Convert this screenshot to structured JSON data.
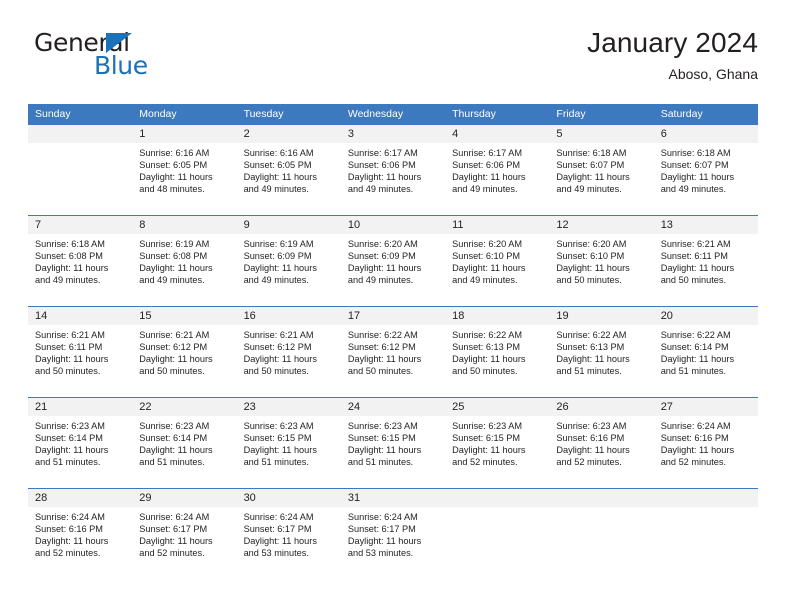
{
  "brand": {
    "name_top": "General",
    "name_bottom": "Blue",
    "triangle_icon": "blue-triangle-icon",
    "color_primary": "#1c71b8",
    "color_text": "#231f20"
  },
  "header": {
    "title": "January 2024",
    "subtitle": "Aboso, Ghana"
  },
  "calendar": {
    "header_bg": "#3d79bf",
    "daynum_bg": "#f2f2f2",
    "weekdays": [
      "Sunday",
      "Monday",
      "Tuesday",
      "Wednesday",
      "Thursday",
      "Friday",
      "Saturday"
    ],
    "weeks": [
      [
        {
          "day": "",
          "sunrise": "",
          "sunset": "",
          "daylight1": "",
          "daylight2": ""
        },
        {
          "day": "1",
          "sunrise": "Sunrise: 6:16 AM",
          "sunset": "Sunset: 6:05 PM",
          "daylight1": "Daylight: 11 hours",
          "daylight2": "and 48 minutes."
        },
        {
          "day": "2",
          "sunrise": "Sunrise: 6:16 AM",
          "sunset": "Sunset: 6:05 PM",
          "daylight1": "Daylight: 11 hours",
          "daylight2": "and 49 minutes."
        },
        {
          "day": "3",
          "sunrise": "Sunrise: 6:17 AM",
          "sunset": "Sunset: 6:06 PM",
          "daylight1": "Daylight: 11 hours",
          "daylight2": "and 49 minutes."
        },
        {
          "day": "4",
          "sunrise": "Sunrise: 6:17 AM",
          "sunset": "Sunset: 6:06 PM",
          "daylight1": "Daylight: 11 hours",
          "daylight2": "and 49 minutes."
        },
        {
          "day": "5",
          "sunrise": "Sunrise: 6:18 AM",
          "sunset": "Sunset: 6:07 PM",
          "daylight1": "Daylight: 11 hours",
          "daylight2": "and 49 minutes."
        },
        {
          "day": "6",
          "sunrise": "Sunrise: 6:18 AM",
          "sunset": "Sunset: 6:07 PM",
          "daylight1": "Daylight: 11 hours",
          "daylight2": "and 49 minutes."
        }
      ],
      [
        {
          "day": "7",
          "sunrise": "Sunrise: 6:18 AM",
          "sunset": "Sunset: 6:08 PM",
          "daylight1": "Daylight: 11 hours",
          "daylight2": "and 49 minutes."
        },
        {
          "day": "8",
          "sunrise": "Sunrise: 6:19 AM",
          "sunset": "Sunset: 6:08 PM",
          "daylight1": "Daylight: 11 hours",
          "daylight2": "and 49 minutes."
        },
        {
          "day": "9",
          "sunrise": "Sunrise: 6:19 AM",
          "sunset": "Sunset: 6:09 PM",
          "daylight1": "Daylight: 11 hours",
          "daylight2": "and 49 minutes."
        },
        {
          "day": "10",
          "sunrise": "Sunrise: 6:20 AM",
          "sunset": "Sunset: 6:09 PM",
          "daylight1": "Daylight: 11 hours",
          "daylight2": "and 49 minutes."
        },
        {
          "day": "11",
          "sunrise": "Sunrise: 6:20 AM",
          "sunset": "Sunset: 6:10 PM",
          "daylight1": "Daylight: 11 hours",
          "daylight2": "and 49 minutes."
        },
        {
          "day": "12",
          "sunrise": "Sunrise: 6:20 AM",
          "sunset": "Sunset: 6:10 PM",
          "daylight1": "Daylight: 11 hours",
          "daylight2": "and 50 minutes."
        },
        {
          "day": "13",
          "sunrise": "Sunrise: 6:21 AM",
          "sunset": "Sunset: 6:11 PM",
          "daylight1": "Daylight: 11 hours",
          "daylight2": "and 50 minutes."
        }
      ],
      [
        {
          "day": "14",
          "sunrise": "Sunrise: 6:21 AM",
          "sunset": "Sunset: 6:11 PM",
          "daylight1": "Daylight: 11 hours",
          "daylight2": "and 50 minutes."
        },
        {
          "day": "15",
          "sunrise": "Sunrise: 6:21 AM",
          "sunset": "Sunset: 6:12 PM",
          "daylight1": "Daylight: 11 hours",
          "daylight2": "and 50 minutes."
        },
        {
          "day": "16",
          "sunrise": "Sunrise: 6:21 AM",
          "sunset": "Sunset: 6:12 PM",
          "daylight1": "Daylight: 11 hours",
          "daylight2": "and 50 minutes."
        },
        {
          "day": "17",
          "sunrise": "Sunrise: 6:22 AM",
          "sunset": "Sunset: 6:12 PM",
          "daylight1": "Daylight: 11 hours",
          "daylight2": "and 50 minutes."
        },
        {
          "day": "18",
          "sunrise": "Sunrise: 6:22 AM",
          "sunset": "Sunset: 6:13 PM",
          "daylight1": "Daylight: 11 hours",
          "daylight2": "and 50 minutes."
        },
        {
          "day": "19",
          "sunrise": "Sunrise: 6:22 AM",
          "sunset": "Sunset: 6:13 PM",
          "daylight1": "Daylight: 11 hours",
          "daylight2": "and 51 minutes."
        },
        {
          "day": "20",
          "sunrise": "Sunrise: 6:22 AM",
          "sunset": "Sunset: 6:14 PM",
          "daylight1": "Daylight: 11 hours",
          "daylight2": "and 51 minutes."
        }
      ],
      [
        {
          "day": "21",
          "sunrise": "Sunrise: 6:23 AM",
          "sunset": "Sunset: 6:14 PM",
          "daylight1": "Daylight: 11 hours",
          "daylight2": "and 51 minutes."
        },
        {
          "day": "22",
          "sunrise": "Sunrise: 6:23 AM",
          "sunset": "Sunset: 6:14 PM",
          "daylight1": "Daylight: 11 hours",
          "daylight2": "and 51 minutes."
        },
        {
          "day": "23",
          "sunrise": "Sunrise: 6:23 AM",
          "sunset": "Sunset: 6:15 PM",
          "daylight1": "Daylight: 11 hours",
          "daylight2": "and 51 minutes."
        },
        {
          "day": "24",
          "sunrise": "Sunrise: 6:23 AM",
          "sunset": "Sunset: 6:15 PM",
          "daylight1": "Daylight: 11 hours",
          "daylight2": "and 51 minutes."
        },
        {
          "day": "25",
          "sunrise": "Sunrise: 6:23 AM",
          "sunset": "Sunset: 6:15 PM",
          "daylight1": "Daylight: 11 hours",
          "daylight2": "and 52 minutes."
        },
        {
          "day": "26",
          "sunrise": "Sunrise: 6:23 AM",
          "sunset": "Sunset: 6:16 PM",
          "daylight1": "Daylight: 11 hours",
          "daylight2": "and 52 minutes."
        },
        {
          "day": "27",
          "sunrise": "Sunrise: 6:24 AM",
          "sunset": "Sunset: 6:16 PM",
          "daylight1": "Daylight: 11 hours",
          "daylight2": "and 52 minutes."
        }
      ],
      [
        {
          "day": "28",
          "sunrise": "Sunrise: 6:24 AM",
          "sunset": "Sunset: 6:16 PM",
          "daylight1": "Daylight: 11 hours",
          "daylight2": "and 52 minutes."
        },
        {
          "day": "29",
          "sunrise": "Sunrise: 6:24 AM",
          "sunset": "Sunset: 6:17 PM",
          "daylight1": "Daylight: 11 hours",
          "daylight2": "and 52 minutes."
        },
        {
          "day": "30",
          "sunrise": "Sunrise: 6:24 AM",
          "sunset": "Sunset: 6:17 PM",
          "daylight1": "Daylight: 11 hours",
          "daylight2": "and 53 minutes."
        },
        {
          "day": "31",
          "sunrise": "Sunrise: 6:24 AM",
          "sunset": "Sunset: 6:17 PM",
          "daylight1": "Daylight: 11 hours",
          "daylight2": "and 53 minutes."
        },
        {
          "day": "",
          "sunrise": "",
          "sunset": "",
          "daylight1": "",
          "daylight2": ""
        },
        {
          "day": "",
          "sunrise": "",
          "sunset": "",
          "daylight1": "",
          "daylight2": ""
        },
        {
          "day": "",
          "sunrise": "",
          "sunset": "",
          "daylight1": "",
          "daylight2": ""
        }
      ]
    ]
  }
}
